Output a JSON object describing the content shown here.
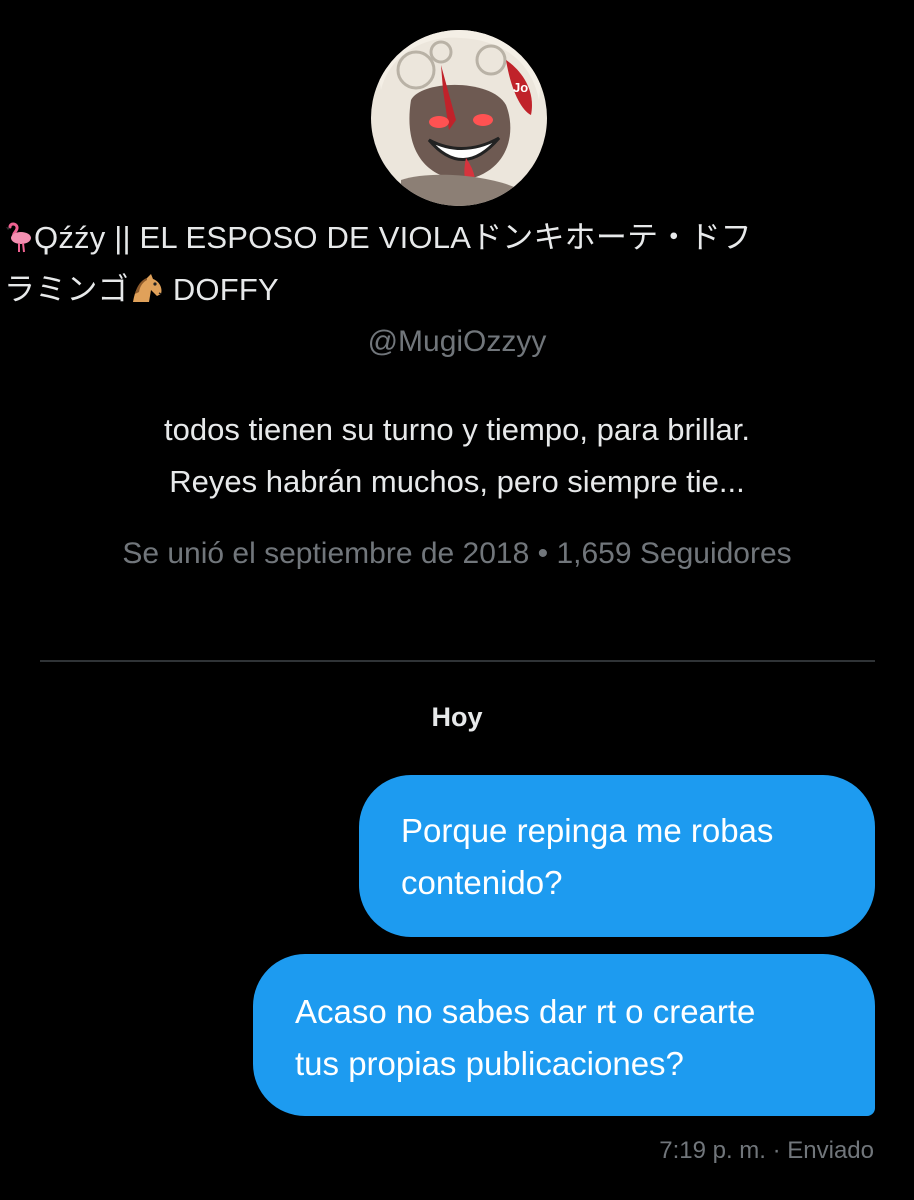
{
  "profile": {
    "avatar_icon": "anime-avatar",
    "display_name_line1": "Ϙźźy  || EL ESPOSO DE VIOLAドンキホーテ・ドフ",
    "display_name_line2_prefix": "ラミンゴ",
    "display_name_line2_suffix": "DOFFY",
    "name_icons": [
      "flamingo-icon",
      "horse-icon"
    ],
    "handle": "@MugiOzzyy",
    "bio_line1": "todos tienen su turno y tiempo, para brillar.",
    "bio_line2": "Reyes habrán muchos, pero siempre tie...",
    "joined": "Se unió el septiembre de 2018",
    "separator": " • ",
    "followers": "1,659 Seguidores"
  },
  "conversation": {
    "day_label": "Hoy",
    "messages": [
      {
        "line1": "Porque repinga me robas",
        "line2": "contenido?"
      },
      {
        "line1": "Acaso no sabes dar rt o crearte",
        "line2": "tus propias publicaciones?"
      }
    ],
    "status": "7:19 p. m. · Enviado"
  },
  "colors": {
    "background": "#000000",
    "bubble": "#1d9bf0",
    "secondary_text": "#71767b",
    "primary_text": "#e7e9ea",
    "divider": "#2f3336"
  }
}
